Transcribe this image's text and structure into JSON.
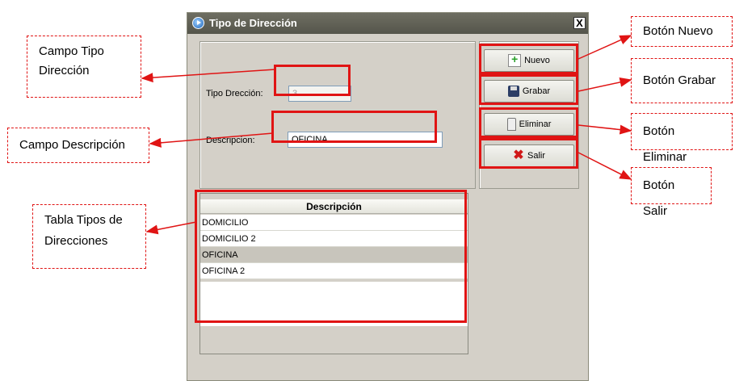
{
  "window": {
    "title": "Tipo de Dirección",
    "close_glyph": "X"
  },
  "form": {
    "tipo_label": "Tipo Drección:",
    "tipo_value": "3",
    "descripcion_label": "Descripcion:",
    "descripcion_value": "OFICINA"
  },
  "buttons": {
    "nuevo": "Nuevo",
    "grabar": "Grabar",
    "eliminar": "Eliminar",
    "salir": "Salir"
  },
  "table": {
    "header": "Descripción",
    "rows": [
      "DOMICILIO",
      "DOMICILIO 2",
      "OFICINA",
      "OFICINA 2"
    ],
    "selected_index": 2
  },
  "callouts": {
    "campo_tipo": [
      "Campo Tipo",
      "Dirección"
    ],
    "campo_descripcion": "Campo Descripción",
    "tabla": [
      "Tabla Tipos de",
      "Direcciones"
    ],
    "boton_nuevo": "Botón Nuevo",
    "boton_grabar": "Botón Grabar",
    "boton_eliminar": "Botón Eliminar",
    "boton_salir": "Botón Salir"
  },
  "colors": {
    "highlight": "#e01414",
    "window_bg": "#d4d0c8",
    "titlebar": "#5f5f55"
  },
  "icons": {
    "title": "app-globe-icon",
    "nuevo": "new-document-icon",
    "grabar": "floppy-disk-icon",
    "eliminar": "trash-icon",
    "salir": "red-x-icon"
  }
}
